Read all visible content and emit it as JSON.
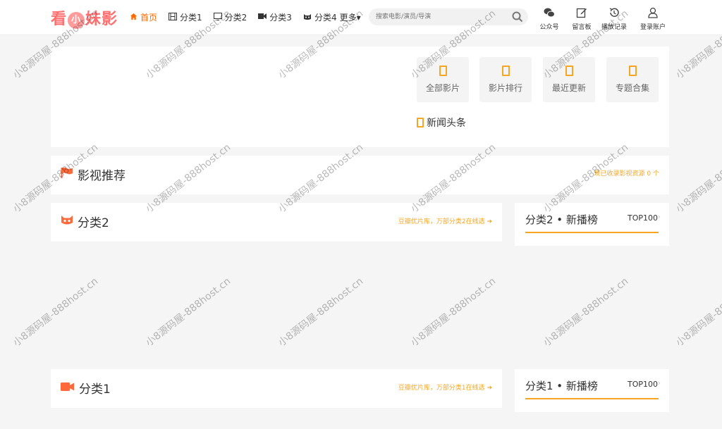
{
  "logo": {
    "left": "看",
    "mid": "小",
    "right": "妹影"
  },
  "nav": [
    {
      "label": "首页",
      "icon": "home-icon",
      "active": true
    },
    {
      "label": "分类1",
      "icon": "film-icon"
    },
    {
      "label": "分类2",
      "icon": "tv-icon"
    },
    {
      "label": "分类3",
      "icon": "video-icon"
    },
    {
      "label": "分类4",
      "icon": "cat-icon"
    },
    {
      "label": "更多▾",
      "icon": "chevron-down-icon"
    }
  ],
  "search": {
    "placeholder": "搜索电影/演员/导演"
  },
  "tools": [
    {
      "label": "公众号",
      "icon": "wechat-icon"
    },
    {
      "label": "留言板",
      "icon": "edit-icon"
    },
    {
      "label": "播放记录",
      "icon": "history-icon"
    },
    {
      "label": "登录账户",
      "icon": "user-icon"
    }
  ],
  "quick_links": [
    "全部影片",
    "影片排行",
    "最近更新",
    "专题合集"
  ],
  "news_label": "新闻头条",
  "recommend": {
    "title": "影视推荐",
    "link": "现已收录影视资源 0 个"
  },
  "sections": [
    {
      "title": "分类2",
      "link": "豆瓣优片库，万部分类2在线选 ➜",
      "rank_title": "分类2 • 新播榜",
      "rank_badge": "TOP100"
    },
    {
      "title": "分类1",
      "link": "豆瓣优片库，万部分类1在线选 ➜",
      "rank_title": "分类1 • 新播榜",
      "rank_badge": "TOP100"
    }
  ],
  "watermark": "小8源码屋-888host.cn",
  "colors": {
    "accent": "#ff6a00",
    "gold": "#f5a623",
    "logo": "#ff6f6f"
  }
}
